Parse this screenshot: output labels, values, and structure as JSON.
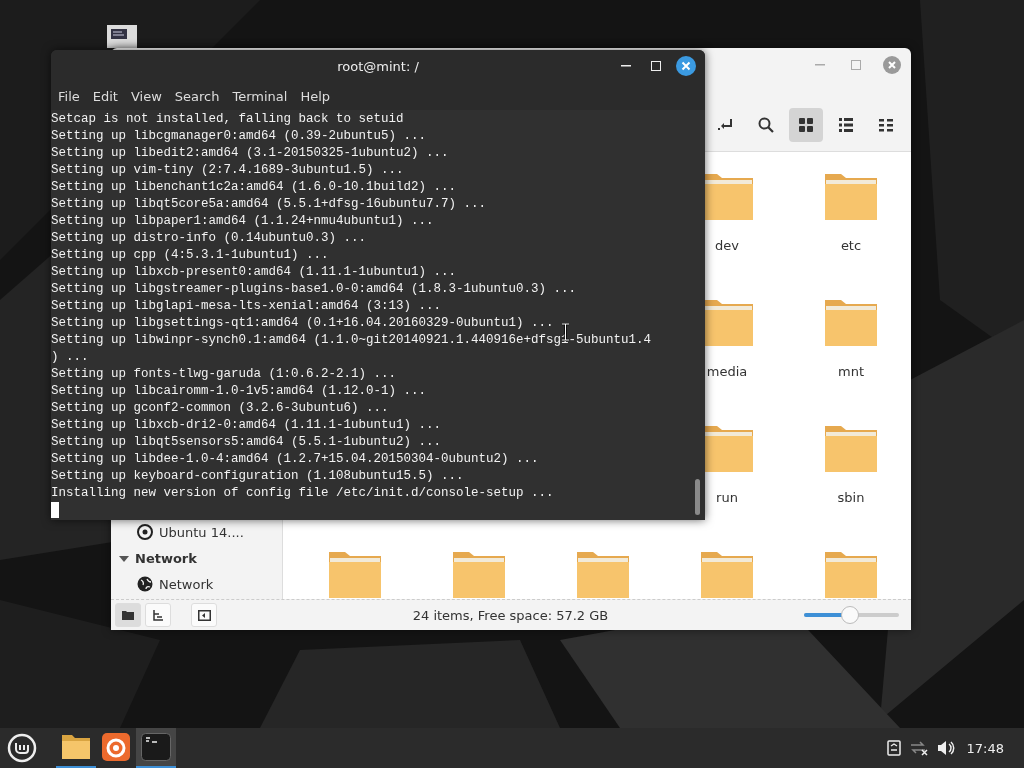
{
  "terminal": {
    "title": "root@mint: /",
    "menu": [
      "File",
      "Edit",
      "View",
      "Search",
      "Terminal",
      "Help"
    ],
    "lines": [
      "Setcap is not installed, falling back to setuid",
      "Setting up libcgmanager0:amd64 (0.39-2ubuntu5) ...",
      "Setting up libedit2:amd64 (3.1-20150325-1ubuntu2) ...",
      "Setting up vim-tiny (2:7.4.1689-3ubuntu1.5) ...",
      "Setting up libenchant1c2a:amd64 (1.6.0-10.1build2) ...",
      "Setting up libqt5core5a:amd64 (5.5.1+dfsg-16ubuntu7.7) ...",
      "Setting up libpaper1:amd64 (1.1.24+nmu4ubuntu1) ...",
      "Setting up distro-info (0.14ubuntu0.3) ...",
      "Setting up cpp (4:5.3.1-1ubuntu1) ...",
      "Setting up libxcb-present0:amd64 (1.11.1-1ubuntu1) ...",
      "Setting up libgstreamer-plugins-base1.0-0:amd64 (1.8.3-1ubuntu0.3) ...",
      "Setting up libglapi-mesa-lts-xenial:amd64 (3:13) ...",
      "Setting up libgsettings-qt1:amd64 (0.1+16.04.20160329-0ubuntu1) ...",
      "Setting up libwinpr-synch0.1:amd64 (1.1.0~git20140921.1.440916e+dfsg1-5ubuntu1.4",
      ") ...",
      "Setting up fonts-tlwg-garuda (1:0.6.2-2.1) ...",
      "Setting up libcairomm-1.0-1v5:amd64 (1.12.0-1) ...",
      "Setting up gconf2-common (3.2.6-3ubuntu6) ...",
      "Setting up libxcb-dri2-0:amd64 (1.11.1-1ubuntu1) ...",
      "Setting up libqt5sensors5:amd64 (5.5.1-1ubuntu2) ...",
      "Setting up libdee-1.0-4:amd64 (1.2.7+15.04.20150304-0ubuntu2) ...",
      "Setting up keyboard-configuration (1.108ubuntu15.5) ...",
      "Installing new version of config file /etc/init.d/console-setup ..."
    ]
  },
  "file_manager": {
    "view_buttons": [
      {
        "kind": "grid",
        "selected": true
      },
      {
        "kind": "list",
        "selected": false
      },
      {
        "kind": "compact",
        "selected": false
      }
    ],
    "sidebar": [
      {
        "kind": "drive",
        "label": "Ubuntu 14...."
      },
      {
        "kind": "header",
        "label": "Network",
        "expanded": true
      },
      {
        "kind": "network",
        "label": "Network"
      }
    ],
    "folder_rows": [
      {
        "folders": [
          {
            "kind": "folder",
            "name": "dev"
          },
          {
            "kind": "folder",
            "name": "etc"
          }
        ]
      },
      {
        "folders": [
          {
            "kind": "folder",
            "name": "media"
          },
          {
            "kind": "folder",
            "name": "mnt"
          }
        ]
      },
      {
        "folders": [
          {
            "kind": "folder",
            "name": "run"
          },
          {
            "kind": "folder",
            "name": "sbin"
          }
        ]
      },
      {
        "folders": [
          {
            "kind": "folder"
          },
          {
            "kind": "folder"
          },
          {
            "kind": "folder"
          },
          {
            "kind": "folder"
          },
          {
            "kind": "folder"
          }
        ]
      }
    ],
    "pane_buttons": [
      {
        "kind": "places",
        "selected": true
      },
      {
        "kind": "tree",
        "selected": false
      },
      {
        "kind": "sidebar",
        "selected": false
      }
    ],
    "status": "24 items, Free space: 57.2 GB",
    "zoom": {
      "level": 0.48
    }
  },
  "taskbar": {
    "apps": [
      {
        "kind": "files",
        "running": true,
        "focused": false
      },
      {
        "kind": "browser",
        "running": false,
        "focused": false
      },
      {
        "kind": "terminal",
        "running": true,
        "focused": true
      }
    ],
    "clock": "17:48"
  }
}
